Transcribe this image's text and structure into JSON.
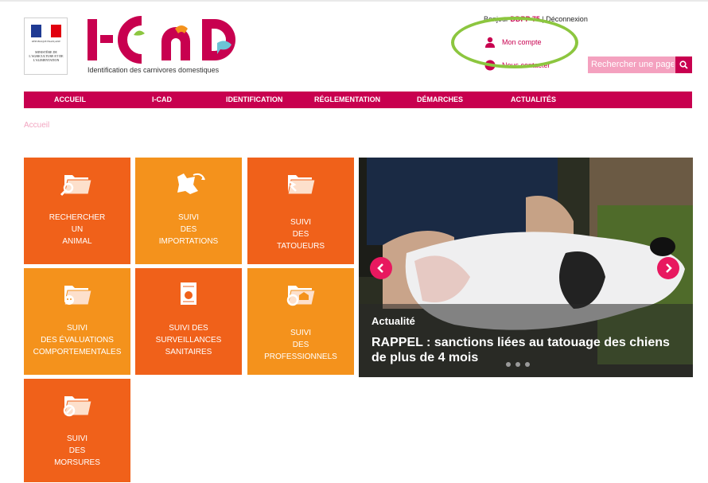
{
  "header": {
    "ministry_republic": "RÉPUBLIQUE FRANÇAISE",
    "ministry_name": "MINISTÈRE DE L'AGRICULTURE ET DE L'ALIMENTATION",
    "brand": "I-CAD",
    "tagline": "Identification des carnivores domestiques",
    "user_prefix": "Bonjour",
    "user_name": "DDPP 75",
    "logout_label": "Déconnexion",
    "account_label": "Mon compte",
    "contact_label": "Nous contacter",
    "search_placeholder": "Rechercher une page",
    "colors": {
      "brand": "#c8004f",
      "highlight": "#8cc63f"
    }
  },
  "nav": {
    "items": [
      {
        "label": "ACCUEIL"
      },
      {
        "label": "I-CAD"
      },
      {
        "label": "IDENTIFICATION"
      },
      {
        "label": "RÉGLEMENTATION"
      },
      {
        "label": "DÉMARCHES"
      },
      {
        "label": "ACTUALITÉS"
      }
    ]
  },
  "breadcrumb": "Accueil",
  "tiles": [
    {
      "lines": [
        "RECHERCHER",
        "UN",
        "ANIMAL"
      ],
      "icon": "folder-search-icon"
    },
    {
      "lines": [
        "SUIVI",
        "DES",
        "IMPORTATIONS"
      ],
      "icon": "import-map-icon"
    },
    {
      "lines": [
        "SUIVI",
        "DES",
        "TATOUEURS"
      ],
      "icon": "folder-tattoo-icon"
    },
    {
      "lines": [
        "SUIVI",
        "DES ÉVALUATIONS",
        "COMPORTEMENTALES"
      ],
      "icon": "folder-behavior-icon"
    },
    {
      "lines": [
        "SUIVI DES",
        "SURVEILLANCES",
        "SANITAIRES"
      ],
      "icon": "health-document-icon"
    },
    {
      "lines": [
        "SUIVI",
        "DES",
        "PROFESSIONNELS"
      ],
      "icon": "folder-professional-icon"
    },
    {
      "lines": [
        "SUIVI",
        "DES",
        "MORSURES"
      ],
      "icon": "folder-bite-icon"
    }
  ],
  "slider": {
    "tag": "Actualité",
    "title": "RAPPEL : sanctions liées au tatouage des chiens de plus de 4 mois"
  }
}
